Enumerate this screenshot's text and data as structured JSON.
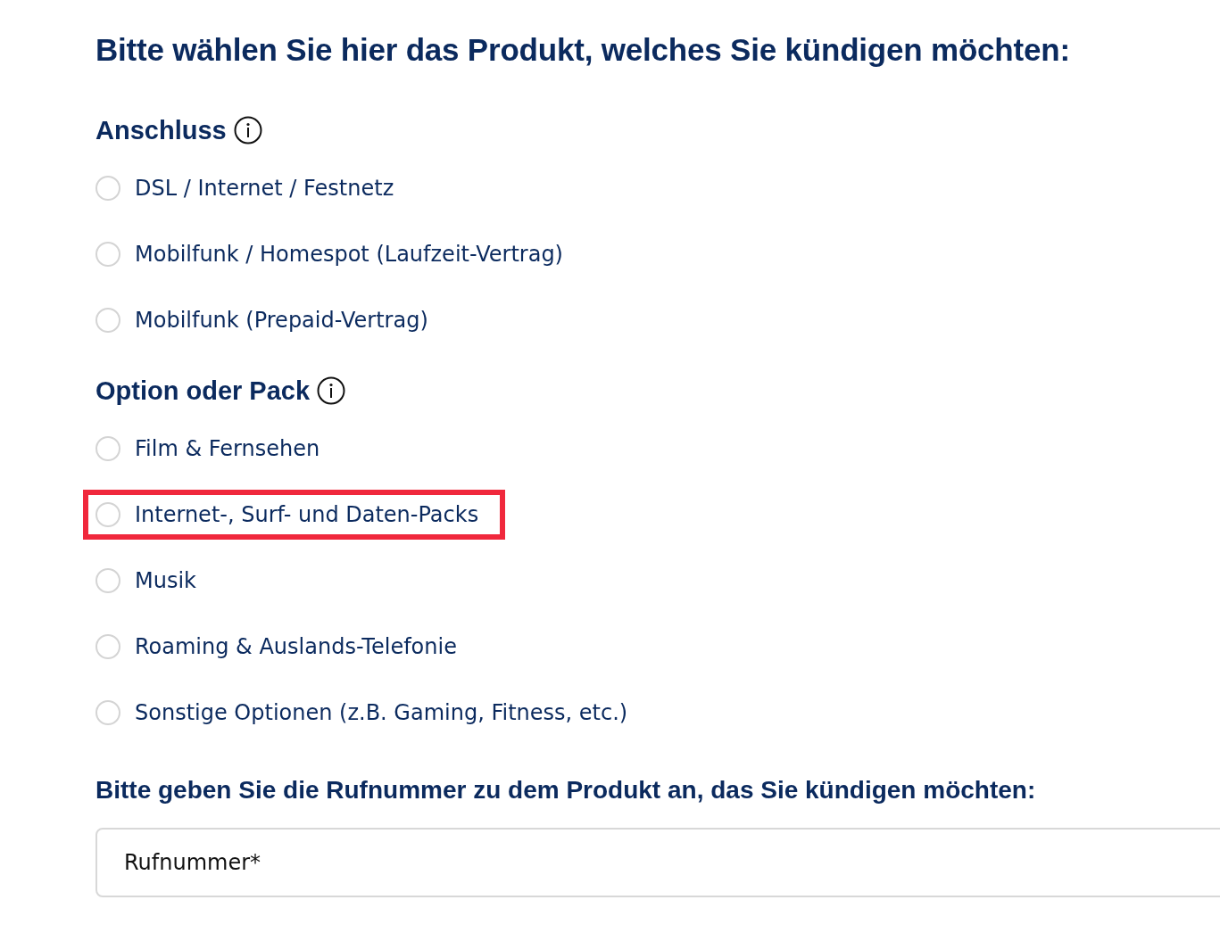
{
  "title": "Bitte wählen Sie hier das Produkt, welches Sie kündigen möchten:",
  "groups": [
    {
      "heading": "Anschluss",
      "options": [
        {
          "label": "DSL / Internet / Festnetz",
          "selected": false,
          "highlighted": false
        },
        {
          "label": "Mobilfunk / Homespot (Laufzeit-Vertrag)",
          "selected": false,
          "highlighted": false
        },
        {
          "label": "Mobilfunk (Prepaid-Vertrag)",
          "selected": false,
          "highlighted": false
        }
      ]
    },
    {
      "heading": "Option oder Pack",
      "options": [
        {
          "label": "Film & Fernsehen",
          "selected": false,
          "highlighted": false
        },
        {
          "label": "Internet-, Surf- und Daten-Packs",
          "selected": false,
          "highlighted": true
        },
        {
          "label": "Musik",
          "selected": false,
          "highlighted": false
        },
        {
          "label": "Roaming & Auslands-Telefonie",
          "selected": false,
          "highlighted": false
        },
        {
          "label": "Sonstige Optionen (z.B. Gaming, Fitness, etc.)",
          "selected": false,
          "highlighted": false
        }
      ]
    }
  ],
  "phone": {
    "heading": "Bitte geben Sie die Rufnummer zu dem Produkt an, das Sie kündigen möchten:",
    "placeholder": "Rufnummer*"
  }
}
